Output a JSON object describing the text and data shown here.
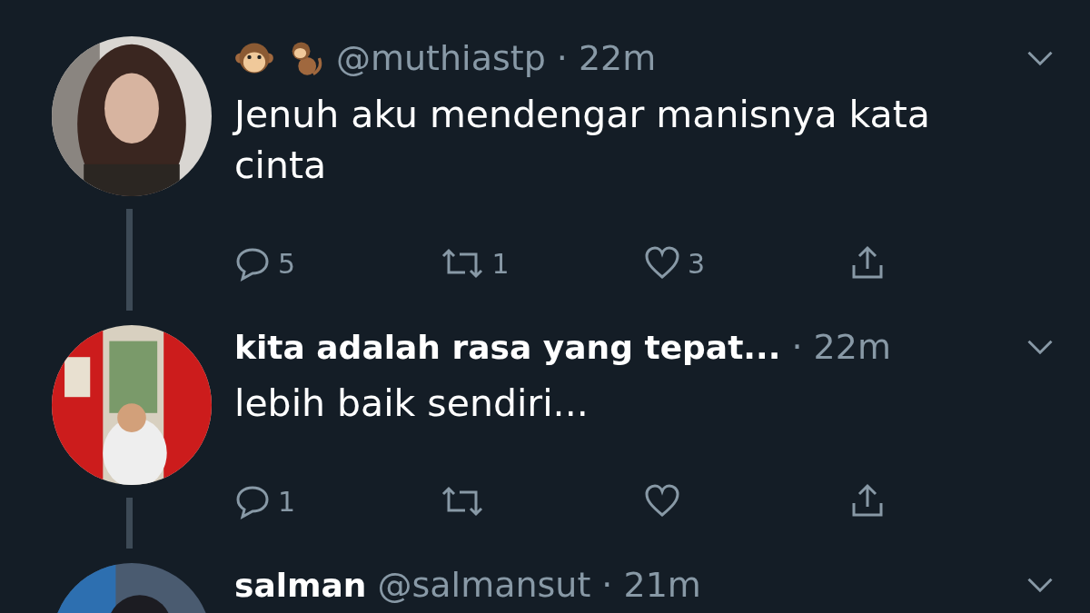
{
  "tweets": [
    {
      "kind": "emoji_name",
      "handle": "@muthiastp",
      "time": "· 22m",
      "text": "Jenuh aku mendengar manisnya kata cinta",
      "actions": {
        "replies": "5",
        "retweets": "1",
        "likes": "3"
      },
      "thread": true
    },
    {
      "kind": "text_name",
      "name": "kita adalah rasa yang tepat...",
      "time": "· 22m",
      "text": "lebih baik sendiri...",
      "actions": {
        "replies": "1"
      },
      "thread": true
    },
    {
      "kind": "text_name",
      "name": "salman",
      "handle": "@salmansut",
      "time": "· 21m",
      "thread": false
    }
  ]
}
